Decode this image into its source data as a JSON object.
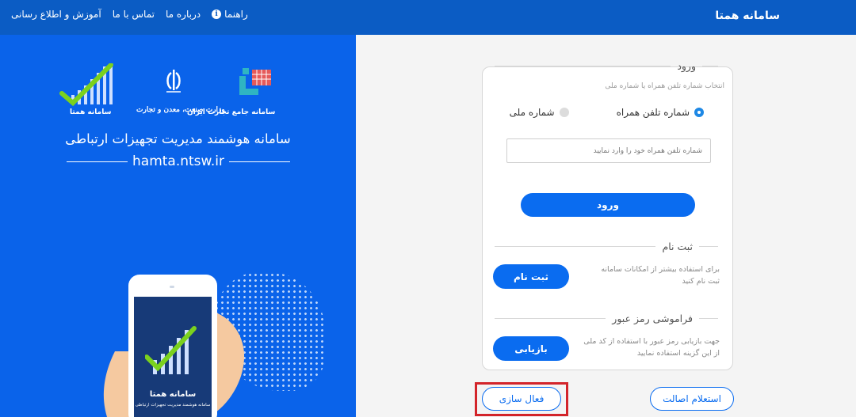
{
  "header": {
    "brand": "سامانه همتا",
    "nav": [
      {
        "label": "آموزش و اطلاع رسانی",
        "name": "nav-training"
      },
      {
        "label": "تماس با ما",
        "name": "nav-contact"
      },
      {
        "label": "درباره ما",
        "name": "nav-about"
      },
      {
        "label": "راهنما",
        "name": "nav-help",
        "icon": "info-icon"
      }
    ]
  },
  "hero": {
    "logo_captions": {
      "trade": "سامانه جامع تجارت ایران",
      "ministry": "وزارت صنعت، معدن و تجارت",
      "hamta": "سامانه همتا"
    },
    "title": "سامانه هوشمند مدیریت تجهیزات ارتباطی",
    "url": "hamta.ntsw.ir",
    "phone_caption_main": "سامانه همتا",
    "phone_caption_sub": "سامانه هوشمند مدیریت تجهیزات ارتباطی",
    "colors": {
      "panel": "#0a63ea",
      "accent_green": "#7bd11e"
    }
  },
  "login": {
    "legend": "ورود",
    "hint": "انتخاب شماره تلفن همراه یا شماره ملی",
    "radio_national": "شماره ملی",
    "radio_mobile": "شماره تلفن همراه",
    "selected": "شماره تلفن همراه",
    "input_placeholder": "شماره تلفن همراه خود را وارد نمایید",
    "input_value": "",
    "submit_label": "ورود"
  },
  "register": {
    "legend": "ثبت نام",
    "desc": "برای استفاده بیشتر از امکانات سامانه ثبت نام کنید",
    "button": "ثبت نام"
  },
  "recovery": {
    "legend": "فراموشی رمز عبور",
    "desc": "جهت بازیابی رمز عبور با استفاده از کد ملی از این گزینه استفاده نمایید",
    "button": "بازیابی"
  },
  "footer_buttons": {
    "inquiry": "استعلام اصالت",
    "activation": "فعال سازی"
  },
  "colors": {
    "primary": "#0a6cf0",
    "topbar": "#0b5cc4",
    "highlight": "#d3242a"
  }
}
